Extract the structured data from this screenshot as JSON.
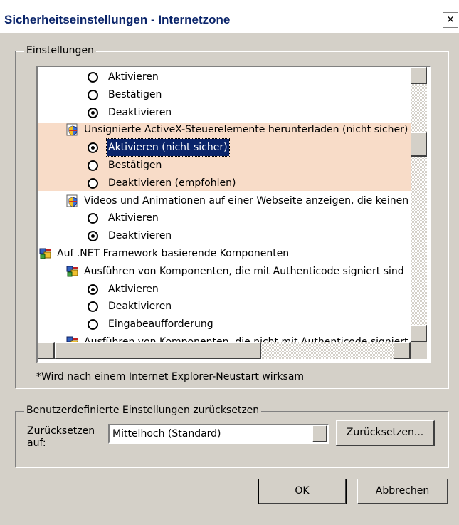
{
  "window": {
    "title": "Sicherheitseinstellungen - Internetzone",
    "close_label": "×"
  },
  "settings_group": {
    "label": "Einstellungen",
    "rows": [
      {
        "kind": "radio",
        "indent": 1,
        "label": "Aktivieren",
        "selected": false
      },
      {
        "kind": "radio",
        "indent": 1,
        "label": "Bestätigen",
        "selected": false
      },
      {
        "kind": "radio",
        "indent": 1,
        "label": "Deaktivieren",
        "selected": true
      },
      {
        "kind": "item",
        "icon": "shield-page-icon",
        "indent": 1,
        "label": "Unsignierte ActiveX-Steuerelemente herunterladen (nicht sicher)"
      },
      {
        "kind": "radio",
        "indent": 1,
        "label": "Aktivieren (nicht sicher)",
        "selected": true,
        "focused": true
      },
      {
        "kind": "radio",
        "indent": 1,
        "label": "Bestätigen",
        "selected": false
      },
      {
        "kind": "radio",
        "indent": 1,
        "label": "Deaktivieren (empfohlen)",
        "selected": false
      },
      {
        "kind": "item",
        "icon": "shield-page-icon",
        "indent": 1,
        "label": "Videos und Animationen auf einer Webseite anzeigen, die keinen externen Mediaplayer verwenden"
      },
      {
        "kind": "radio",
        "indent": 1,
        "label": "Aktivieren",
        "selected": false
      },
      {
        "kind": "radio",
        "indent": 1,
        "label": "Deaktivieren",
        "selected": true
      },
      {
        "kind": "category",
        "icon": "net-components-icon",
        "indent": 0,
        "label": "Auf .NET Framework basierende Komponenten"
      },
      {
        "kind": "item",
        "icon": "net-components-icon",
        "indent": 1,
        "label": "Ausführen von Komponenten, die mit Authenticode signiert sind"
      },
      {
        "kind": "radio",
        "indent": 1,
        "label": "Aktivieren",
        "selected": true
      },
      {
        "kind": "radio",
        "indent": 1,
        "label": "Deaktivieren",
        "selected": false
      },
      {
        "kind": "radio",
        "indent": 1,
        "label": "Eingabeaufforderung",
        "selected": false
      },
      {
        "kind": "item",
        "icon": "net-components-icon",
        "indent": 1,
        "label": "Ausführen von Komponenten, die nicht mit Authenticode signiert sind"
      }
    ],
    "note": "*Wird nach einem Internet Explorer-Neustart wirksam"
  },
  "reset_group": {
    "label": "Benutzerdefinierte Einstellungen zurücksetzen",
    "reset_to_label_line1": "Zurücksetzen",
    "reset_to_label_line2": "auf:",
    "level_value": "Mittelhoch (Standard)",
    "reset_button": "Zurücksetzen..."
  },
  "footer": {
    "ok_label": "OK",
    "cancel_label": "Abbrechen"
  },
  "colors": {
    "highlight_bg": "#f8dcc8",
    "selection_bg": "#0a246a",
    "dialog_bg": "#d4d0c8"
  }
}
